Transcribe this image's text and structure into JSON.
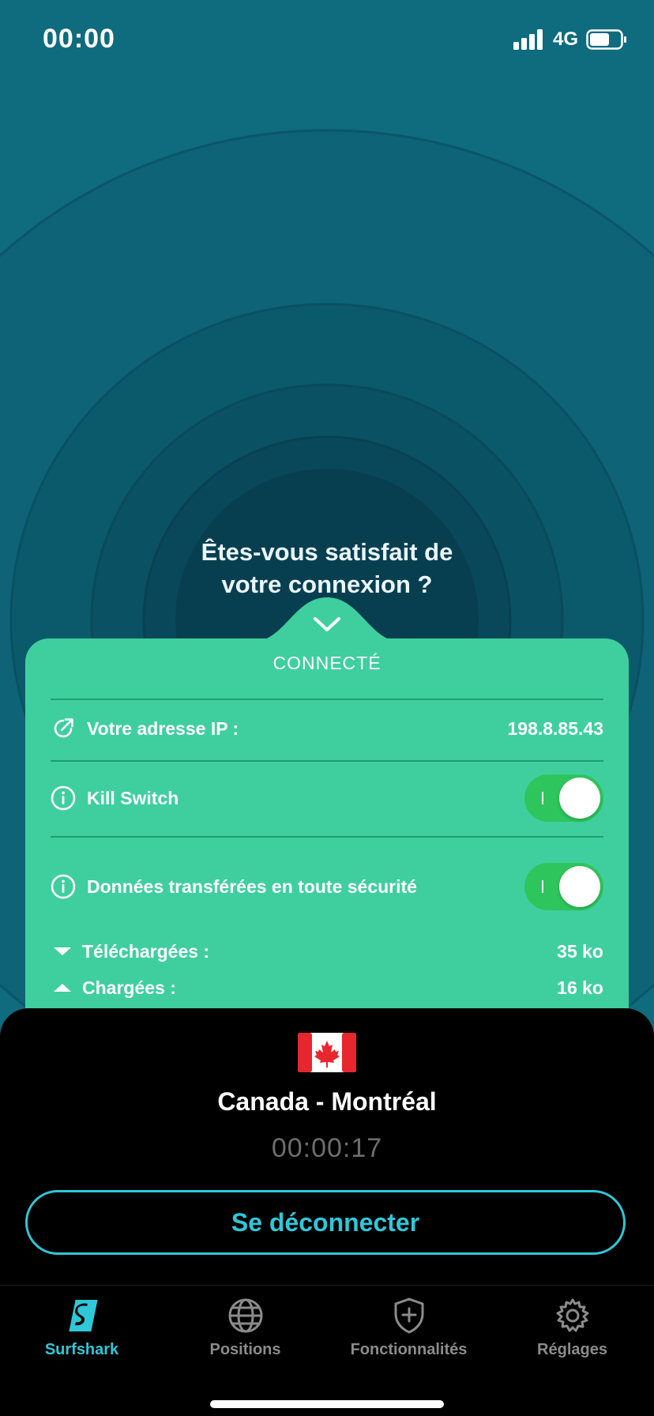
{
  "status_bar": {
    "time": "00:00",
    "network": "4G"
  },
  "question": {
    "line1": "Êtes-vous satisfait de",
    "line2": "votre connexion ?"
  },
  "card": {
    "status": "CONNECTÉ",
    "ip_label": "Votre adresse IP :",
    "ip_value": "198.8.85.43",
    "kill_switch_label": "Kill Switch",
    "kill_switch_on": true,
    "secure_data_label": "Données transférées en toute sécurité",
    "secure_data_on": true,
    "downloaded_label": "Téléchargées :",
    "downloaded_value": "35 ko",
    "uploaded_label": "Chargées :",
    "uploaded_value": "16 ko"
  },
  "connection": {
    "location": "Canada - Montréal",
    "timer": "00:00:17",
    "disconnect_label": "Se déconnecter"
  },
  "tabs": [
    {
      "label": "Surfshark",
      "icon": "surfshark-logo-icon",
      "active": true
    },
    {
      "label": "Positions",
      "icon": "globe-icon",
      "active": false
    },
    {
      "label": "Fonctionnalités",
      "icon": "shield-plus-icon",
      "active": false
    },
    {
      "label": "Réglages",
      "icon": "gear-icon",
      "active": false
    }
  ],
  "colors": {
    "accent": "#2ec8d9",
    "card": "#3fcf9e",
    "toggle": "#2ec55c",
    "background": "#10697c"
  }
}
